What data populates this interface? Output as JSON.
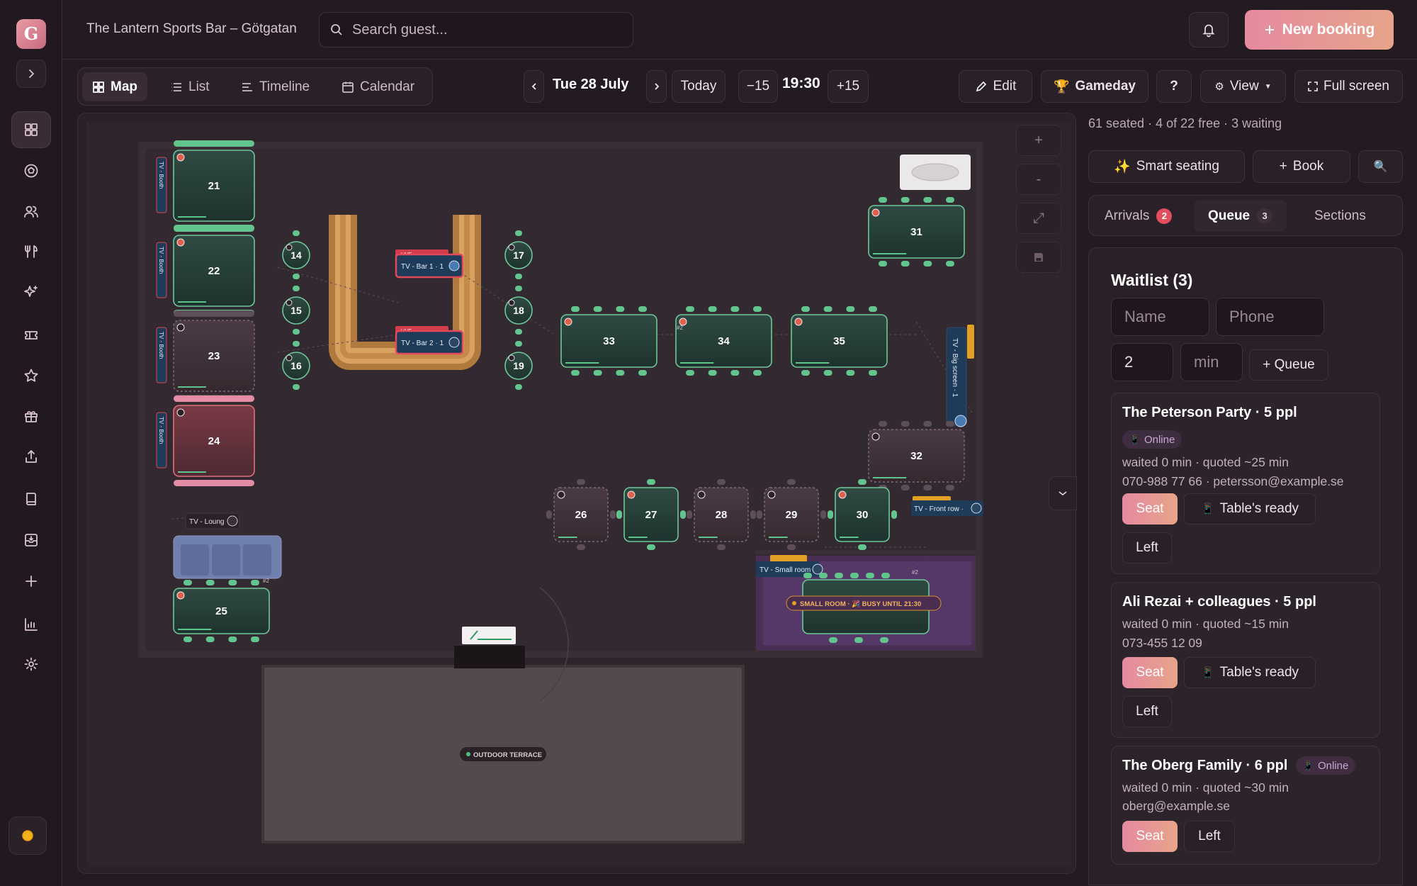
{
  "app": {
    "logo_letter": "G",
    "venue_name": "The Lantern Sports Bar – Götgatan",
    "accent": "#e58aa0"
  },
  "search": {
    "placeholder": "Search guest..."
  },
  "header": {
    "new_booking_label": "New booking",
    "bell_icon": "bell-icon"
  },
  "sidebar": {
    "items": [
      {
        "icon": "grid-icon",
        "active": true
      },
      {
        "icon": "soccer-ball-icon"
      },
      {
        "icon": "users-icon"
      },
      {
        "icon": "cutlery-icon"
      },
      {
        "icon": "sparkles-icon"
      },
      {
        "icon": "ticket-icon"
      },
      {
        "icon": "star-icon"
      },
      {
        "icon": "gift-icon"
      },
      {
        "icon": "upload-icon"
      },
      {
        "icon": "book-icon"
      },
      {
        "icon": "archive-icon"
      },
      {
        "icon": "plus-icon"
      },
      {
        "icon": "bar-chart-icon"
      },
      {
        "icon": "gear-icon"
      }
    ],
    "theme_icon": "sun-icon"
  },
  "views": {
    "tabs": [
      {
        "label": "Map",
        "icon": "grid-icon",
        "active": true
      },
      {
        "label": "List",
        "icon": "list-icon"
      },
      {
        "label": "Timeline",
        "icon": "timeline-icon"
      },
      {
        "label": "Calendar",
        "icon": "calendar-icon"
      }
    ]
  },
  "datebar": {
    "date": "Tue 28 July",
    "today_label": "Today",
    "minus_label": "−15",
    "time": "19:30",
    "plus_label": "+15"
  },
  "actions": {
    "edit_label": "Edit",
    "gameday_label": "Gameday",
    "help_label": "?",
    "view_label": "View",
    "fullscreen_label": "Full screen"
  },
  "floor": {
    "tables": [
      {
        "id": "21",
        "kind": "booth",
        "state": "seated"
      },
      {
        "id": "22",
        "kind": "booth",
        "state": "seated"
      },
      {
        "id": "23",
        "kind": "booth",
        "state": "free"
      },
      {
        "id": "24",
        "kind": "booth",
        "state": "late"
      },
      {
        "id": "25",
        "kind": "rect",
        "state": "seated"
      },
      {
        "id": "14",
        "kind": "round",
        "state": "seated"
      },
      {
        "id": "15",
        "kind": "round",
        "state": "seated"
      },
      {
        "id": "16",
        "kind": "round",
        "state": "seated"
      },
      {
        "id": "17",
        "kind": "round",
        "state": "seated"
      },
      {
        "id": "18",
        "kind": "round",
        "state": "seated"
      },
      {
        "id": "19",
        "kind": "round",
        "state": "seated"
      },
      {
        "id": "33",
        "kind": "rect",
        "state": "seated"
      },
      {
        "id": "34",
        "kind": "rect",
        "state": "seated"
      },
      {
        "id": "35",
        "kind": "rect",
        "state": "seated"
      },
      {
        "id": "31",
        "kind": "rect",
        "state": "seated"
      },
      {
        "id": "32",
        "kind": "rect",
        "state": "free"
      },
      {
        "id": "26",
        "kind": "square",
        "state": "free"
      },
      {
        "id": "27",
        "kind": "square",
        "state": "seated"
      },
      {
        "id": "28",
        "kind": "square",
        "state": "free"
      },
      {
        "id": "29",
        "kind": "square",
        "state": "free"
      },
      {
        "id": "30",
        "kind": "square",
        "state": "seated"
      }
    ],
    "tvs": {
      "booth": "TV - Booth",
      "lounge": "TV - Loung",
      "bar1": "TV - Bar 1 · 1",
      "bar2": "TV - Bar 2 · 1",
      "big": "TV - Big screen · 1",
      "front": "TV - Front row ·",
      "small": "TV - Small room"
    },
    "badges": {
      "live": "LIVE",
      "hash2": "#2"
    },
    "small_room_label": "SMALL ROOM · 🎉 BUSY UNTIL 21:30",
    "terrace_label": "OUTDOOR TERRACE"
  },
  "right": {
    "stats": "61 seated · 4 of 22 free · 3 waiting",
    "smart_seating": "Smart seating",
    "book_label": "Book",
    "tabs": [
      {
        "label": "Arrivals",
        "badge": "2"
      },
      {
        "label": "Queue",
        "badge": "3",
        "active": true
      },
      {
        "label": "Sections"
      }
    ],
    "waitlist_title": "Waitlist (3)",
    "form": {
      "name_placeholder": "Name",
      "phone_placeholder": "Phone",
      "size_value": "2",
      "min_placeholder": "min",
      "queue_label": "+ Queue"
    },
    "entries": [
      {
        "title": "The Peterson Party · 5 ppl",
        "source": "Online",
        "waited": "waited 0 min · quoted ~25 min",
        "contact": "070-988 77 66 · petersson@example.se",
        "seat": "Seat",
        "ready": "Table's ready",
        "left": "Left"
      },
      {
        "title": "Ali Rezai + colleagues · 5 ppl",
        "waited": "waited 0 min · quoted ~15 min",
        "contact": "073-455 12 09",
        "seat": "Seat",
        "ready": "Table's ready",
        "left": "Left"
      },
      {
        "title": "The Oberg Family · 6 ppl",
        "source": "Online",
        "waited": "waited 0 min · quoted ~30 min",
        "contact": "oberg@example.se",
        "seat": "Seat",
        "left": "Left"
      }
    ]
  }
}
